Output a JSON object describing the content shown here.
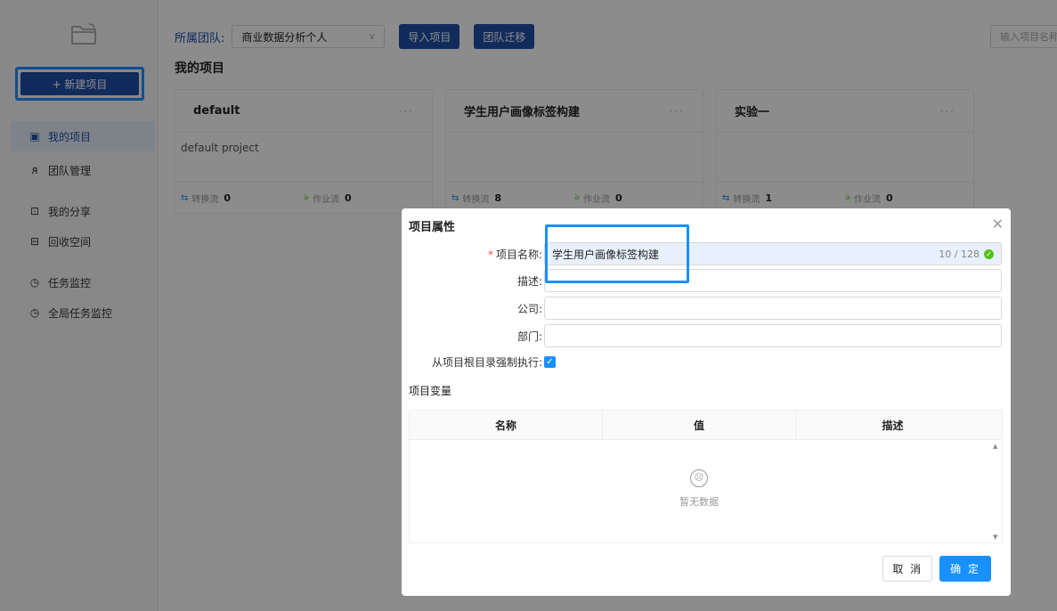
{
  "sidebar": {
    "new_project_label": "+ 新建项目",
    "items": [
      {
        "label": "我的项目",
        "icon": "▣"
      },
      {
        "label": "团队管理",
        "icon": "ᴙ"
      },
      {
        "label": "我的分享",
        "icon": "⊡"
      },
      {
        "label": "回收空间",
        "icon": "⊟"
      },
      {
        "label": "任务监控",
        "icon": "◷"
      },
      {
        "label": "全局任务监控",
        "icon": "◷"
      }
    ]
  },
  "topbar": {
    "team_label": "所属团队:",
    "team_value": "商业数据分析个人",
    "import_label": "导入项目",
    "migrate_label": "团队迁移",
    "search_placeholder": "输入项目名称"
  },
  "page_title": "我的项目",
  "cards": [
    {
      "title": "default",
      "desc": "default project",
      "convert_label": "转换流",
      "convert_count": "0",
      "job_label": "作业流",
      "job_count": "0"
    },
    {
      "title": "学生用户画像标签构建",
      "desc": "",
      "convert_label": "转换流",
      "convert_count": "8",
      "job_label": "作业流",
      "job_count": "0"
    },
    {
      "title": "实验一",
      "desc": "",
      "convert_label": "转换流",
      "convert_count": "1",
      "job_label": "作业流",
      "job_count": "0"
    }
  ],
  "modal": {
    "title": "项目属性",
    "fields": {
      "name_label": "项目名称:",
      "name_value": "学生用户画像标签构建",
      "name_count": "10 / 128",
      "desc_label": "描述:",
      "company_label": "公司:",
      "dept_label": "部门:",
      "force_label": "从项目根目录强制执行:"
    },
    "vars_title": "项目变量",
    "table_headers": [
      "名称",
      "值",
      "描述"
    ],
    "empty_text": "暂无数据",
    "cancel_label": "取 消",
    "ok_label": "确 定"
  },
  "colors": {
    "primary": "#1f4fa8",
    "accent": "#1890ff",
    "success": "#52c41a"
  }
}
